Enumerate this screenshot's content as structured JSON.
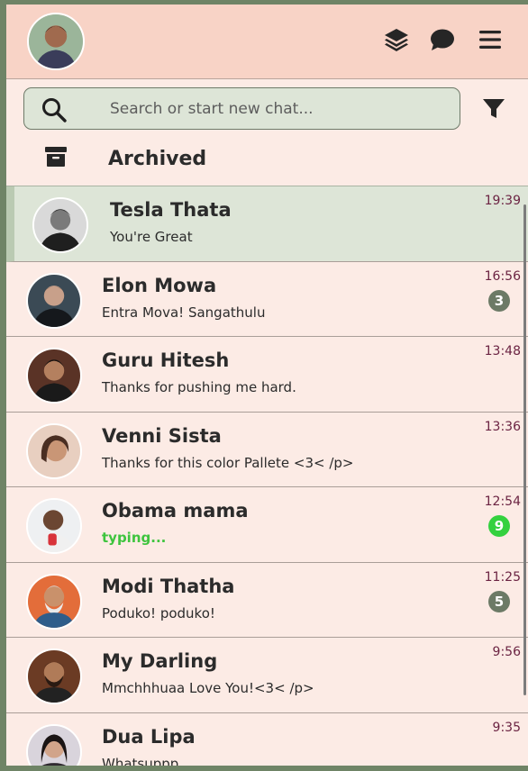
{
  "header": {
    "avatar_name": "profile-avatar",
    "icons": [
      "layers-icon",
      "chat-bubble-icon",
      "menu-icon"
    ]
  },
  "search": {
    "placeholder": "Search or start new chat..."
  },
  "archived": {
    "label": "Archived"
  },
  "colors": {
    "header_bg": "#f8d3c6",
    "panel_bg": "#fcebe5",
    "active_bg": "#dde5d7",
    "time": "#6b2342",
    "badge": "#6c7a66",
    "badge_green": "#34d13f",
    "typing": "#3ec43e"
  },
  "chats": [
    {
      "name": "Tesla Thata",
      "message": "You're Great",
      "time": "19:39",
      "unread": "",
      "active": true,
      "typing": false
    },
    {
      "name": "Elon Mowa",
      "message": "Entra Mova! Sangathulu",
      "time": "16:56",
      "unread": "3",
      "active": false,
      "typing": false
    },
    {
      "name": "Guru Hitesh",
      "message": "Thanks for pushing me hard.",
      "time": "13:48",
      "unread": "",
      "active": false,
      "typing": false
    },
    {
      "name": "Venni Sista",
      "message": "Thanks for this color Pallete <3< /p>",
      "time": "13:36",
      "unread": "",
      "active": false,
      "typing": false
    },
    {
      "name": "Obama mama",
      "message": "typing...",
      "time": "12:54",
      "unread": "9",
      "active": false,
      "typing": true
    },
    {
      "name": "Modi Thatha",
      "message": "Poduko! poduko!",
      "time": "11:25",
      "unread": "5",
      "active": false,
      "typing": false
    },
    {
      "name": "My Darling",
      "message": "Mmchhhuaa Love You!<3< /p>",
      "time": "9:56",
      "unread": "",
      "active": false,
      "typing": false
    },
    {
      "name": "Dua Lipa",
      "message": "Whatsuppp",
      "time": "9:35",
      "unread": "",
      "active": false,
      "typing": false
    }
  ]
}
